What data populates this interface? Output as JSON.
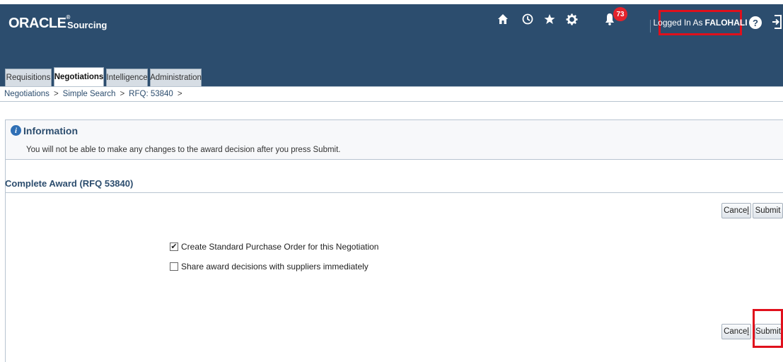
{
  "header": {
    "logo": "ORACLE",
    "logo_mark": "®",
    "app_name": "Sourcing",
    "notification_count": "73",
    "logged_in_prefix": "Logged In As",
    "logged_in_user": "FALOHALI",
    "help": "?",
    "icons": [
      "home-icon",
      "navigator-icon",
      "favorites-icon",
      "settings-icon",
      "notifications-icon",
      "help-icon",
      "logout-icon"
    ]
  },
  "tabs": [
    {
      "label": "Requisitions",
      "active": false
    },
    {
      "label": "Negotiations",
      "active": true
    },
    {
      "label": "Intelligence",
      "active": false
    },
    {
      "label": "Administration",
      "active": false
    }
  ],
  "breadcrumb": [
    "Negotiations",
    "Simple Search",
    "RFQ: 53840"
  ],
  "breadcrumb_sep": ">",
  "info": {
    "title": "Information",
    "message": "You will not be able to make any changes to the award decision after you press Submit."
  },
  "section": {
    "title": "Complete Award (RFQ 53840)"
  },
  "buttons": {
    "cancel_prefix": "Cance",
    "cancel_accel": "l",
    "submit": "Submit"
  },
  "options": [
    {
      "label": "Create Standard Purchase Order for this Negotiation",
      "checked": true
    },
    {
      "label": "Share award decisions with suppliers immediately",
      "checked": false
    }
  ],
  "colors": {
    "header_bg": "#2c4d6e",
    "highlight": "#e0101c",
    "badge": "#e3232c"
  }
}
